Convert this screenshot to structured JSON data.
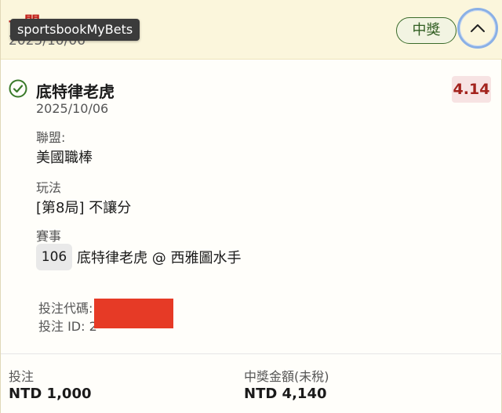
{
  "header": {
    "title": "一關",
    "date": "2025/10/06",
    "status": "中獎"
  },
  "tooltip": {
    "text": "sportsbookMyBets"
  },
  "selection": {
    "name": "底特律老虎",
    "date": "2025/10/06",
    "odds": "4.14"
  },
  "fields": {
    "league_label": "聯盟:",
    "league_value": "美國職棒",
    "market_label": "玩法",
    "market_value": "[第8局] 不讓分",
    "event_label": "賽事",
    "event_number": "106",
    "event_name": "底特律老虎 @ 西雅圖水手"
  },
  "meta": {
    "code_label": "投注代碼:",
    "id_label": "投注 ID: 2"
  },
  "footer": {
    "stake_label": "投注",
    "stake_value": "NTD 1,000",
    "payout_label": "中獎金額(未稅)",
    "payout_value": "NTD 4,140"
  },
  "colors": {
    "header_bg": "#fbf6dc",
    "status_green": "#2f5d20",
    "odds_red": "#a3231d",
    "redaction": "#e63a26"
  },
  "icons": {
    "check": "check-circle-icon",
    "collapse": "chevron-up-icon"
  }
}
